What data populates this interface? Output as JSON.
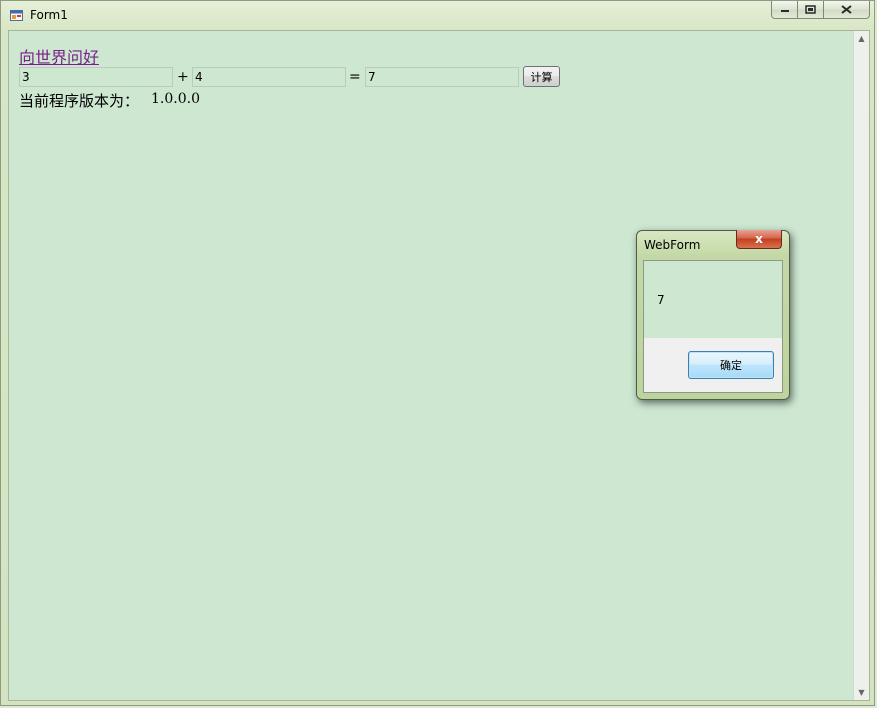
{
  "window": {
    "title": "Form1",
    "icon": "form-app-icon",
    "controls": {
      "minimize_icon": "minimize-icon",
      "maximize_icon": "maximize-icon",
      "close_icon": "close-icon"
    }
  },
  "form": {
    "greeting_link": "向世界问好",
    "operand_a": "3",
    "plus_sign": "+",
    "operand_b": "4",
    "equals_sign": "=",
    "result": "7",
    "calc_button": "计算",
    "version_label": "当前程序版本为：",
    "version_value": "1.0.0.0"
  },
  "dialog": {
    "title": "WebForm",
    "close_glyph": "x",
    "message": "7",
    "ok_button": "确定"
  },
  "colors": {
    "client_background": "#cde7d1",
    "link_color": "#7a1f8a",
    "dialog_frame": "#bdd49e",
    "close_button": "#c2401f"
  }
}
